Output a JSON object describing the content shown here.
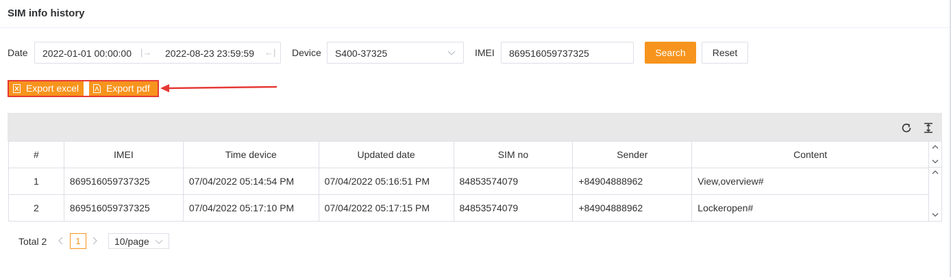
{
  "header": {
    "title": "SIM info history"
  },
  "filters": {
    "date_label": "Date",
    "date_start": "2022-01-01 00:00:00",
    "date_end": "2022-08-23 23:59:59",
    "device_label": "Device",
    "device_value": "S400-37325",
    "imei_label": "IMEI",
    "imei_value": "869516059737325",
    "search_label": "Search",
    "reset_label": "Reset"
  },
  "export": {
    "excel_label": "Export excel",
    "pdf_label": "Export pdf",
    "highlight_color": "#e53935"
  },
  "table": {
    "columns": [
      "#",
      "IMEI",
      "Time device",
      "Updated date",
      "SIM no",
      "Sender",
      "Content"
    ],
    "rows": [
      [
        "1",
        "869516059737325",
        "07/04/2022 05:14:54 PM",
        "07/04/2022 05:16:51 PM",
        "84853574079",
        "+84904888962",
        "View,overview#"
      ],
      [
        "2",
        "869516059737325",
        "07/04/2022 05:17:10 PM",
        "07/04/2022 05:17:15 PM",
        "84853574079",
        "+84904888962",
        "Lockeropen#"
      ]
    ]
  },
  "pagination": {
    "total": "Total 2",
    "current_page": "1",
    "page_size": "10/page"
  },
  "icons": {
    "refresh": "refresh-icon",
    "column_height": "column-height-icon",
    "excel": "file-excel-icon",
    "pdf": "file-pdf-icon"
  },
  "colors": {
    "accent": "#f7941d",
    "border": "#dcdfe6",
    "toolbar_bg": "#e8e8e8"
  }
}
